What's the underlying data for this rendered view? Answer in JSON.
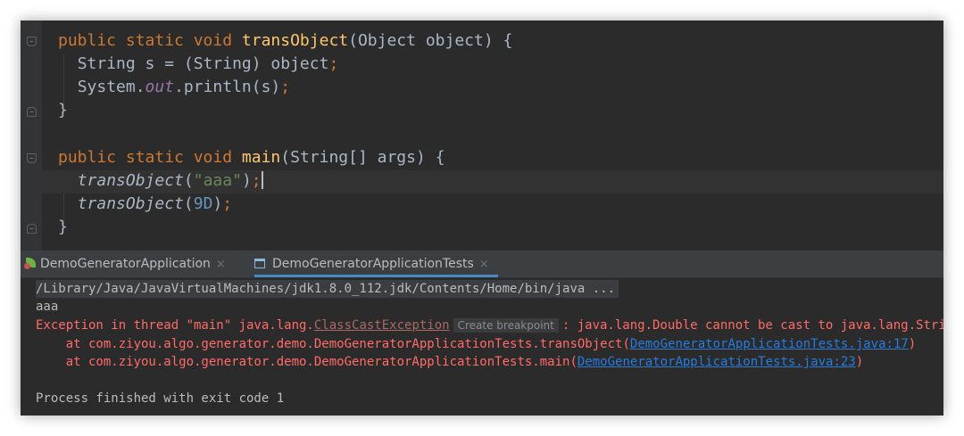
{
  "editor": {
    "lines": {
      "l1": {
        "kw": "public static void ",
        "fn": "transObject",
        "rest": "(Object object) {"
      },
      "l2": {
        "text": "String s = (String) object",
        "semi": ";"
      },
      "l3": {
        "pre": "System.",
        "field": "out",
        "post": ".println(s)",
        "semi": ";"
      },
      "l4": {
        "text": "}"
      },
      "l6": {
        "kw": "public static void ",
        "fn": "main",
        "rest": "(String[] args) {"
      },
      "l7": {
        "call": "transObject",
        "open": "(",
        "str": "\"aaa\"",
        "close": ")",
        "semi": ";"
      },
      "l8": {
        "call": "transObject",
        "open": "(",
        "num": "9D",
        "close": ")",
        "semi": ";"
      },
      "l9": {
        "text": "}"
      }
    }
  },
  "run": {
    "tabs": [
      {
        "label": "DemoGeneratorApplication",
        "close": "×"
      },
      {
        "label": "DemoGeneratorApplicationTests",
        "close": "×"
      }
    ],
    "console": {
      "command": "/Library/Java/JavaVirtualMachines/jdk1.8.0_112.jdk/Contents/Home/bin/java ...",
      "output": "aaa",
      "exception_prefix": "Exception in thread \"main\" java.lang.",
      "exception_class": "ClassCastException",
      "breakpoint_hint": "Create breakpoint",
      "exception_message": ": java.lang.Double cannot be cast to java.lang.String",
      "stack": [
        {
          "at": "    at com.ziyou.algo.generator.demo.DemoGeneratorApplicationTests.transObject(",
          "link": "DemoGeneratorApplicationTests.java:17",
          "end": ")"
        },
        {
          "at": "    at com.ziyou.algo.generator.demo.DemoGeneratorApplicationTests.main(",
          "link": "DemoGeneratorApplicationTests.java:23",
          "end": ")"
        }
      ],
      "exit": "Process finished with exit code 1"
    }
  },
  "colors": {
    "editor_bg": "#2b2b2b",
    "keyword": "#cc7832",
    "method": "#ffc66d",
    "string": "#6a8759",
    "number": "#6897bb",
    "error": "#ff6b68",
    "link": "#287bde"
  }
}
